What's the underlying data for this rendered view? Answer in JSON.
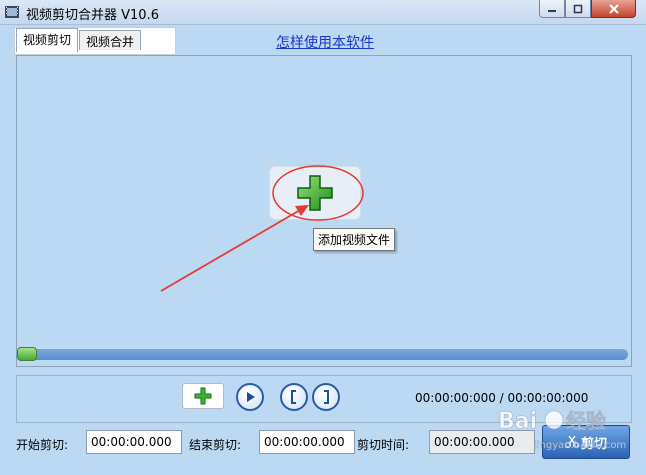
{
  "window": {
    "title": "视频剪切合并器 V10.6",
    "controls": [
      "minimize",
      "maximize",
      "close"
    ]
  },
  "tabs": [
    {
      "label": "视频剪切",
      "active": true
    },
    {
      "label": "视频合并",
      "active": false
    }
  ],
  "help_link": "怎样使用本软件",
  "video_area": {
    "add_button_icon": "plus-icon",
    "tooltip": "添加视频文件"
  },
  "timeline": {
    "position": 0
  },
  "playback": {
    "buttons": [
      "add",
      "play",
      "mark-start",
      "mark-end"
    ],
    "current_time": "00:00:00:000",
    "separator": "/",
    "total_time": "00:00:00:000"
  },
  "cut_fields": {
    "start_label": "开始剪切:",
    "start_value": "00:00:00.000",
    "end_label": "结束剪切:",
    "end_value": "00:00:00.000",
    "duration_label": "剪切时间:",
    "duration_value": "00:00:00.000"
  },
  "cut_button": "剪切",
  "colors": {
    "accent": "#1a36c8",
    "plus": "#2fb52a",
    "annotation": "#e53935"
  }
}
